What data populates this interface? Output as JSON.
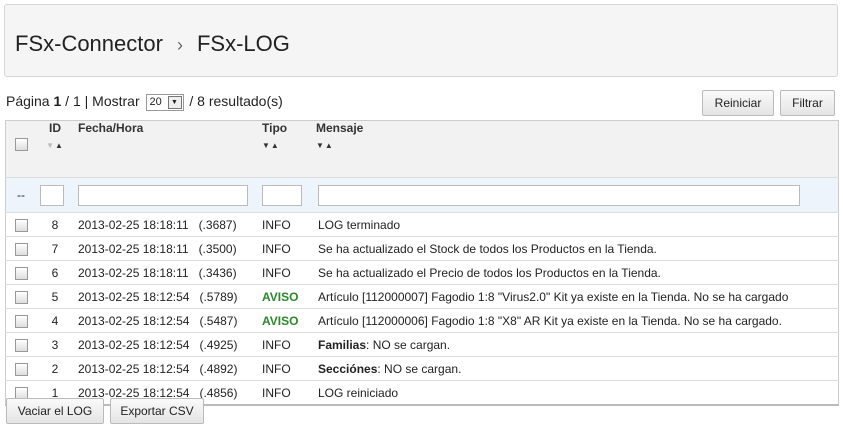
{
  "header": {
    "crumb1": "FSx-Connector",
    "sep": "›",
    "crumb2": "FSx-LOG"
  },
  "pagination": {
    "label": "Página",
    "page": "1",
    "total": "/ 1",
    "show": "| Mostrar",
    "per_page": "20",
    "results": "/ 8 resultado(s)"
  },
  "toolbar": {
    "reset": "Reiniciar",
    "filter": "Filtrar"
  },
  "columns": {
    "id": "ID",
    "fecha": "Fecha/Hora",
    "tipo": "Tipo",
    "mensaje": "Mensaje"
  },
  "filter_row": {
    "marker": "--"
  },
  "rows": [
    {
      "id": "8",
      "fecha": "2013-02-25 18:18:11",
      "ms": "(.3687)",
      "tipo": "INFO",
      "bold": "",
      "msg": "LOG terminado"
    },
    {
      "id": "7",
      "fecha": "2013-02-25 18:18:11",
      "ms": "(.3500)",
      "tipo": "INFO",
      "bold": "",
      "msg": "Se ha actualizado el Stock de todos los Productos en la Tienda."
    },
    {
      "id": "6",
      "fecha": "2013-02-25 18:18:11",
      "ms": "(.3436)",
      "tipo": "INFO",
      "bold": "",
      "msg": "Se ha actualizado el Precio de todos los Productos en la Tienda."
    },
    {
      "id": "5",
      "fecha": "2013-02-25 18:12:54",
      "ms": "(.5789)",
      "tipo": "AVISO",
      "bold": "",
      "msg": "Artículo [112000007] Fagodio 1:8 \"Virus2.0\" Kit ya existe en la Tienda. No se ha cargado"
    },
    {
      "id": "4",
      "fecha": "2013-02-25 18:12:54",
      "ms": "(.5487)",
      "tipo": "AVISO",
      "bold": "",
      "msg": "Artículo [112000006] Fagodio 1:8 \"X8\" AR Kit ya existe en la Tienda. No se ha cargado."
    },
    {
      "id": "3",
      "fecha": "2013-02-25 18:12:54",
      "ms": "(.4925)",
      "tipo": "INFO",
      "bold": "Familias",
      "msg": ": NO se cargan."
    },
    {
      "id": "2",
      "fecha": "2013-02-25 18:12:54",
      "ms": "(.4892)",
      "tipo": "INFO",
      "bold": "Secciónes",
      "msg": ": NO se cargan."
    },
    {
      "id": "1",
      "fecha": "2013-02-25 18:12:54",
      "ms": "(.4856)",
      "tipo": "INFO",
      "bold": "",
      "msg": "LOG reiniciado"
    }
  ],
  "footer": {
    "empty": "Vaciar el LOG",
    "export": "Exportar CSV"
  }
}
